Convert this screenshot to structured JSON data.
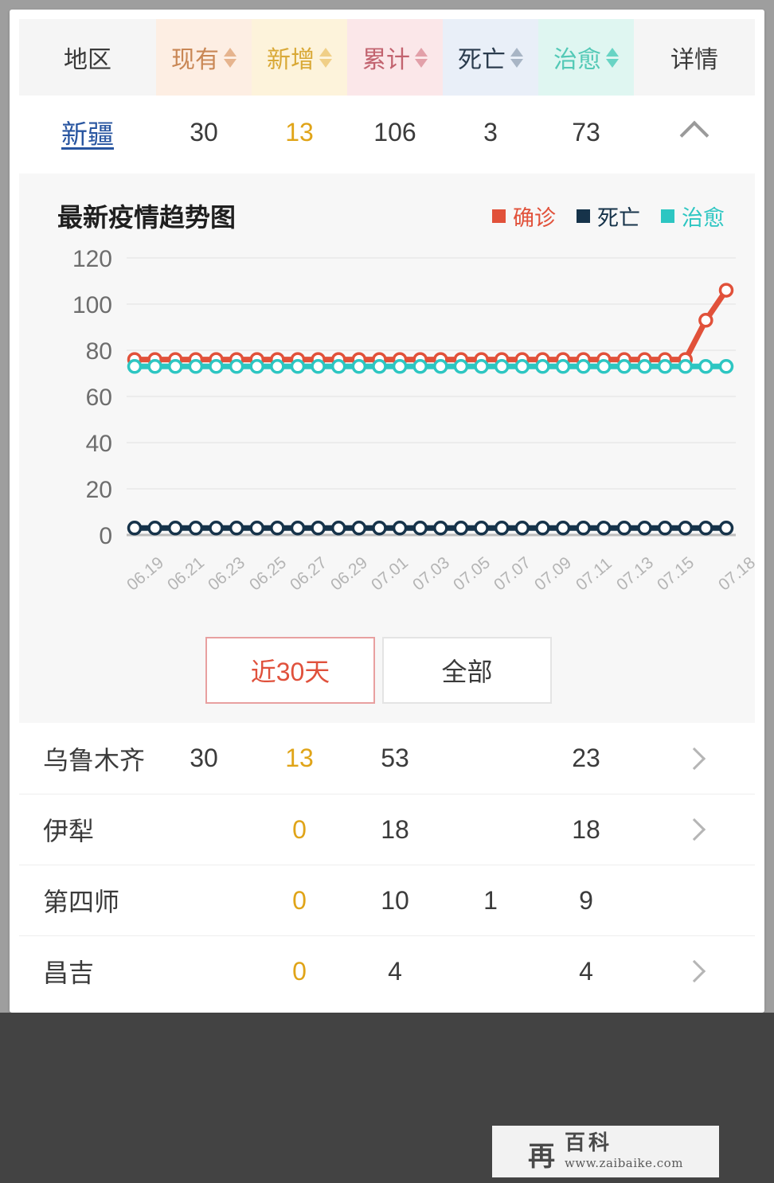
{
  "table": {
    "headers": [
      {
        "label": "地区",
        "sortable": false,
        "key": "region"
      },
      {
        "label": "现有",
        "sortable": true,
        "key": "current"
      },
      {
        "label": "新增",
        "sortable": true,
        "key": "new"
      },
      {
        "label": "累计",
        "sortable": true,
        "key": "total"
      },
      {
        "label": "死亡",
        "sortable": true,
        "key": "death"
      },
      {
        "label": "治愈",
        "sortable": true,
        "key": "cured"
      },
      {
        "label": "详情",
        "sortable": false,
        "key": "detail"
      }
    ],
    "province": {
      "name": "新疆",
      "current": "30",
      "new": "13",
      "total": "106",
      "death": "3",
      "cured": "73",
      "toggle_icon": "chevron-up-icon"
    },
    "cities": [
      {
        "name": "乌鲁木齐",
        "current": "30",
        "new": "13",
        "total": "53",
        "death": "",
        "cured": "23",
        "has_arrow": true
      },
      {
        "name": "伊犁",
        "current": "",
        "new": "0",
        "total": "18",
        "death": "",
        "cured": "18",
        "has_arrow": true
      },
      {
        "name": "第四师",
        "current": "",
        "new": "0",
        "total": "10",
        "death": "1",
        "cured": "9",
        "has_arrow": false
      },
      {
        "name": "昌吉",
        "current": "",
        "new": "0",
        "total": "4",
        "death": "",
        "cured": "4",
        "has_arrow": true
      }
    ]
  },
  "chart_panel": {
    "title": "最新疫情趋势图",
    "legend": [
      {
        "label": "确诊",
        "color": "#e1513a"
      },
      {
        "label": "死亡",
        "color": "#16334a"
      },
      {
        "label": "治愈",
        "color": "#2dc6c2"
      }
    ],
    "range_buttons": [
      {
        "label": "近30天",
        "active": true
      },
      {
        "label": "全部",
        "active": false
      }
    ]
  },
  "chart_data": {
    "type": "line",
    "title": "最新疫情趋势图",
    "xlabel": "",
    "ylabel": "",
    "ylim": [
      0,
      120
    ],
    "yticks": [
      0,
      20,
      40,
      60,
      80,
      100,
      120
    ],
    "grid": true,
    "legend_position": "top-right",
    "x": [
      "06.19",
      "06.20",
      "06.21",
      "06.22",
      "06.23",
      "06.24",
      "06.25",
      "06.26",
      "06.27",
      "06.28",
      "06.29",
      "06.30",
      "07.01",
      "07.02",
      "07.03",
      "07.04",
      "07.05",
      "07.06",
      "07.07",
      "07.08",
      "07.09",
      "07.10",
      "07.11",
      "07.12",
      "07.13",
      "07.14",
      "07.15",
      "07.16",
      "07.17",
      "07.18"
    ],
    "xtick_labels": [
      "06.19",
      "06.21",
      "06.23",
      "06.25",
      "06.27",
      "06.29",
      "07.01",
      "07.03",
      "07.05",
      "07.07",
      "07.09",
      "07.11",
      "07.13",
      "07.15",
      "07.18"
    ],
    "series": [
      {
        "name": "确诊",
        "color": "#e1513a",
        "values": [
          76,
          76,
          76,
          76,
          76,
          76,
          76,
          76,
          76,
          76,
          76,
          76,
          76,
          76,
          76,
          76,
          76,
          76,
          76,
          76,
          76,
          76,
          76,
          76,
          76,
          76,
          76,
          76,
          93,
          106
        ]
      },
      {
        "name": "死亡",
        "color": "#16334a",
        "values": [
          3,
          3,
          3,
          3,
          3,
          3,
          3,
          3,
          3,
          3,
          3,
          3,
          3,
          3,
          3,
          3,
          3,
          3,
          3,
          3,
          3,
          3,
          3,
          3,
          3,
          3,
          3,
          3,
          3,
          3
        ]
      },
      {
        "name": "治愈",
        "color": "#2dc6c2",
        "values": [
          73,
          73,
          73,
          73,
          73,
          73,
          73,
          73,
          73,
          73,
          73,
          73,
          73,
          73,
          73,
          73,
          73,
          73,
          73,
          73,
          73,
          73,
          73,
          73,
          73,
          73,
          73,
          73,
          73,
          73
        ]
      }
    ]
  },
  "watermark": {
    "logo": "再",
    "kanji": "百科",
    "url": "www.zaibaike.com"
  }
}
